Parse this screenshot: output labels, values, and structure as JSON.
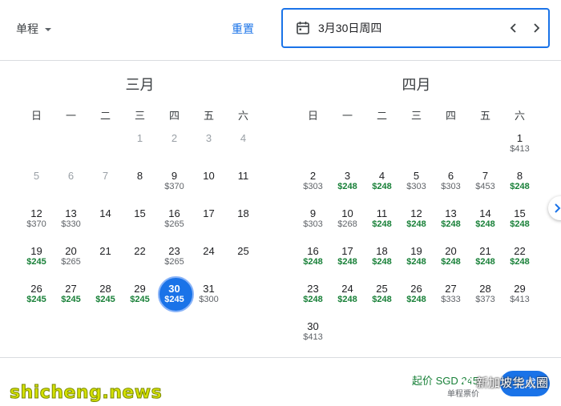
{
  "header": {
    "trip_type": "单程",
    "reset_label": "重置",
    "selected_date": "3月30日周四"
  },
  "weekdays": [
    "日",
    "一",
    "二",
    "三",
    "四",
    "五",
    "六"
  ],
  "months": [
    {
      "title": "三月",
      "days": [
        {
          "d": "1",
          "p": "",
          "muted": true,
          "low": false
        },
        {
          "d": "2",
          "p": "",
          "muted": true,
          "low": false
        },
        {
          "d": "3",
          "p": "",
          "muted": true,
          "low": false
        },
        {
          "d": "4",
          "p": "",
          "muted": true,
          "low": false
        },
        {
          "d": "5",
          "p": "",
          "muted": true,
          "low": false
        },
        {
          "d": "6",
          "p": "",
          "muted": true,
          "low": false
        },
        {
          "d": "7",
          "p": "",
          "muted": true,
          "low": false
        },
        {
          "d": "8",
          "p": "",
          "muted": false,
          "low": false
        },
        {
          "d": "9",
          "p": "$370",
          "muted": false,
          "low": false
        },
        {
          "d": "10",
          "p": "",
          "muted": false,
          "low": false
        },
        {
          "d": "11",
          "p": "",
          "muted": false,
          "low": false
        },
        {
          "d": "12",
          "p": "$370",
          "muted": false,
          "low": false
        },
        {
          "d": "13",
          "p": "$330",
          "muted": false,
          "low": false
        },
        {
          "d": "14",
          "p": "",
          "muted": false,
          "low": false
        },
        {
          "d": "15",
          "p": "",
          "muted": false,
          "low": false
        },
        {
          "d": "16",
          "p": "$265",
          "muted": false,
          "low": false
        },
        {
          "d": "17",
          "p": "",
          "muted": false,
          "low": false
        },
        {
          "d": "18",
          "p": "",
          "muted": false,
          "low": false
        },
        {
          "d": "19",
          "p": "$245",
          "muted": false,
          "low": true
        },
        {
          "d": "20",
          "p": "$265",
          "muted": false,
          "low": false
        },
        {
          "d": "21",
          "p": "",
          "muted": false,
          "low": false
        },
        {
          "d": "22",
          "p": "",
          "muted": false,
          "low": false
        },
        {
          "d": "23",
          "p": "$265",
          "muted": false,
          "low": false
        },
        {
          "d": "24",
          "p": "",
          "muted": false,
          "low": false
        },
        {
          "d": "25",
          "p": "",
          "muted": false,
          "low": false
        },
        {
          "d": "26",
          "p": "$245",
          "muted": false,
          "low": true
        },
        {
          "d": "27",
          "p": "$245",
          "muted": false,
          "low": true
        },
        {
          "d": "28",
          "p": "$245",
          "muted": false,
          "low": true
        },
        {
          "d": "29",
          "p": "$245",
          "muted": false,
          "low": true
        },
        {
          "d": "30",
          "p": "$245",
          "muted": false,
          "low": true,
          "selected": true
        },
        {
          "d": "31",
          "p": "$300",
          "muted": false,
          "low": false
        }
      ]
    },
    {
      "title": "四月",
      "days": [
        {
          "d": "1",
          "p": "$413",
          "muted": false,
          "low": false
        },
        {
          "d": "2",
          "p": "$303",
          "muted": false,
          "low": false
        },
        {
          "d": "3",
          "p": "$248",
          "muted": false,
          "low": true
        },
        {
          "d": "4",
          "p": "$248",
          "muted": false,
          "low": true
        },
        {
          "d": "5",
          "p": "$303",
          "muted": false,
          "low": false
        },
        {
          "d": "6",
          "p": "$303",
          "muted": false,
          "low": false
        },
        {
          "d": "7",
          "p": "$453",
          "muted": false,
          "low": false
        },
        {
          "d": "8",
          "p": "$248",
          "muted": false,
          "low": true
        },
        {
          "d": "9",
          "p": "$303",
          "muted": false,
          "low": false
        },
        {
          "d": "10",
          "p": "$268",
          "muted": false,
          "low": false
        },
        {
          "d": "11",
          "p": "$248",
          "muted": false,
          "low": true
        },
        {
          "d": "12",
          "p": "$248",
          "muted": false,
          "low": true
        },
        {
          "d": "13",
          "p": "$248",
          "muted": false,
          "low": true
        },
        {
          "d": "14",
          "p": "$248",
          "muted": false,
          "low": true
        },
        {
          "d": "15",
          "p": "$248",
          "muted": false,
          "low": true
        },
        {
          "d": "16",
          "p": "$248",
          "muted": false,
          "low": true
        },
        {
          "d": "17",
          "p": "$248",
          "muted": false,
          "low": true
        },
        {
          "d": "18",
          "p": "$248",
          "muted": false,
          "low": true
        },
        {
          "d": "19",
          "p": "$248",
          "muted": false,
          "low": true
        },
        {
          "d": "20",
          "p": "$248",
          "muted": false,
          "low": true
        },
        {
          "d": "21",
          "p": "$248",
          "muted": false,
          "low": true
        },
        {
          "d": "22",
          "p": "$248",
          "muted": false,
          "low": true
        },
        {
          "d": "23",
          "p": "$248",
          "muted": false,
          "low": true
        },
        {
          "d": "24",
          "p": "$248",
          "muted": false,
          "low": true
        },
        {
          "d": "25",
          "p": "$248",
          "muted": false,
          "low": true
        },
        {
          "d": "26",
          "p": "$248",
          "muted": false,
          "low": true
        },
        {
          "d": "27",
          "p": "$333",
          "muted": false,
          "low": false
        },
        {
          "d": "28",
          "p": "$373",
          "muted": false,
          "low": false
        },
        {
          "d": "29",
          "p": "$413",
          "muted": false,
          "low": false
        },
        {
          "d": "30",
          "p": "$413",
          "muted": false,
          "low": false
        }
      ]
    }
  ],
  "footer": {
    "price": "起价 SGD 245",
    "sub": "单程票价",
    "done_label": "完成"
  },
  "watermark": {
    "left": "shicheng.news",
    "right": "新加坡华人圈"
  },
  "colors": {
    "accent": "#1a73e8",
    "low_price": "#188038",
    "muted": "#9aa0a6"
  }
}
